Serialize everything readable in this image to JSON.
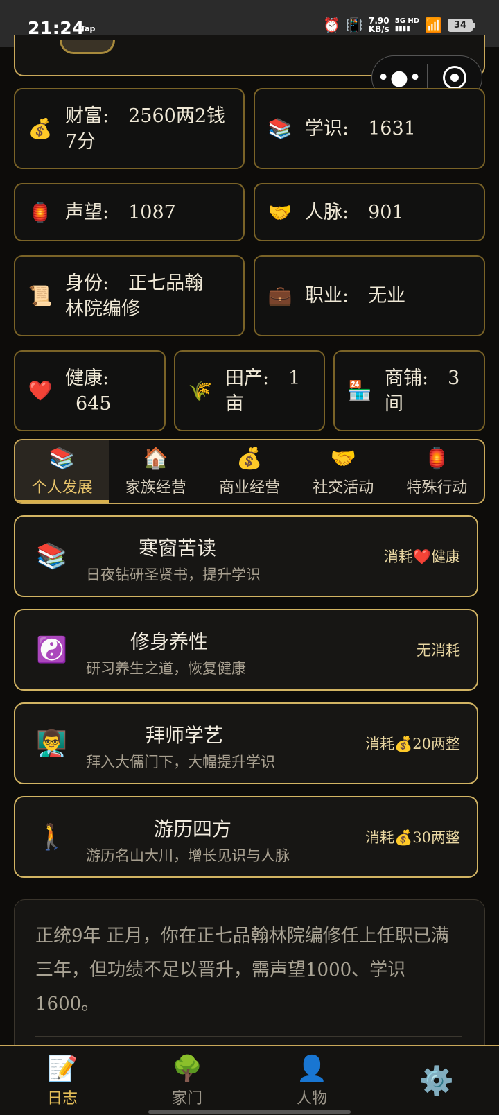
{
  "status_bar": {
    "time": "21:24",
    "app_tag": "Tap",
    "speed_value": "7.90",
    "speed_unit": "KB/s",
    "network_top": "5G HD",
    "network_bottom": "▮▮▮▮",
    "battery": "34",
    "icons": [
      "alarm-icon",
      "vibrate-icon",
      "wifi-icon"
    ]
  },
  "capsule": {
    "more_label": "•●•"
  },
  "stats": {
    "wealth": {
      "icon": "💰",
      "label": "财富:",
      "value": "2560两2钱",
      "value2": "7分"
    },
    "knowledge": {
      "icon": "📚",
      "label": "学识:",
      "value": "1631"
    },
    "prestige": {
      "icon": "🏮",
      "label": "声望:",
      "value": "1087"
    },
    "connections": {
      "icon": "🤝",
      "label": "人脉:",
      "value": "901"
    },
    "status": {
      "icon": "📜",
      "label": "身份:",
      "value": "正七品翰",
      "value2": "林院编修"
    },
    "profession": {
      "icon": "💼",
      "label": "职业:",
      "value": "无业"
    },
    "health": {
      "icon": "❤️",
      "label": "健康:",
      "value": "645"
    },
    "farmland": {
      "icon": "🌾",
      "label": "田产:",
      "value": "1",
      "value2": "亩"
    },
    "shops": {
      "icon": "🏪",
      "label": "商铺:",
      "value": "3",
      "value2": "间"
    }
  },
  "tabs": [
    {
      "icon": "📚",
      "label": "个人发展",
      "active": true
    },
    {
      "icon": "🏠",
      "label": "家族经营"
    },
    {
      "icon": "💰",
      "label": "商业经营"
    },
    {
      "icon": "🤝",
      "label": "社交活动"
    },
    {
      "icon": "🏮",
      "label": "特殊行动"
    }
  ],
  "actions": [
    {
      "icon": "📚",
      "title": "寒窗苦读",
      "desc": "日夜钻研圣贤书，提升学识",
      "cost": "消耗❤️健康"
    },
    {
      "icon": "☯️",
      "title": "修身养性",
      "desc": "研习养生之道，恢复健康",
      "cost": "无消耗"
    },
    {
      "icon": "👨‍🏫",
      "title": "拜师学艺",
      "desc": "拜入大儒门下，大幅提升学识",
      "cost": "消耗💰20两整"
    },
    {
      "icon": "🚶",
      "title": "游历四方",
      "desc": "游历名山大川，增长见识与人脉",
      "cost": "消耗💰30两整"
    }
  ],
  "log": {
    "text": "正统9年 正月，你在正七品翰林院编修任上任职已满三年，但功绩不足以晋升，需声望1000、学识1600。"
  },
  "bottom_nav": [
    {
      "icon": "📝",
      "label": "日志",
      "active": true
    },
    {
      "icon": "🌳",
      "label": "家门"
    },
    {
      "icon": "👤",
      "label": "人物"
    },
    {
      "icon": "⚙️",
      "label": ""
    }
  ],
  "colors": {
    "accent_gold": "#c9a85a",
    "active_tab_text": "#e7c36a",
    "background": "#0d0c0a"
  }
}
